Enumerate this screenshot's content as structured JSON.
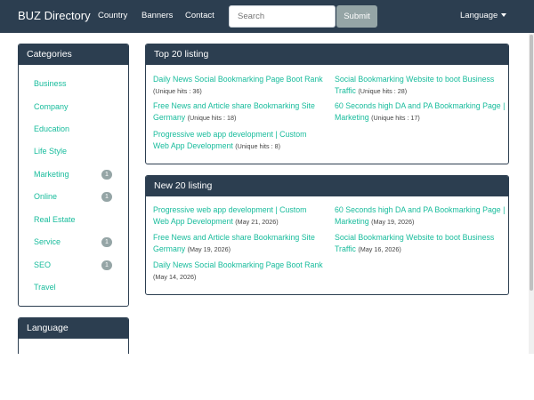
{
  "navbar": {
    "brand": "BUZ Directory",
    "links": [
      "Country",
      "Banners",
      "Contact"
    ],
    "search_placeholder": "Search",
    "submit_label": "Submit",
    "language_label": "Language"
  },
  "categories": {
    "title": "Categories",
    "items": [
      {
        "label": "Business",
        "badge": ""
      },
      {
        "label": "Company",
        "badge": ""
      },
      {
        "label": "Education",
        "badge": ""
      },
      {
        "label": "Life Style",
        "badge": ""
      },
      {
        "label": "Marketing",
        "badge": "1"
      },
      {
        "label": "Online",
        "badge": "1"
      },
      {
        "label": "Real Estate",
        "badge": ""
      },
      {
        "label": "Service",
        "badge": "1"
      },
      {
        "label": "SEO",
        "badge": "1"
      },
      {
        "label": "Travel",
        "badge": ""
      }
    ]
  },
  "language_panel": {
    "title": "Language"
  },
  "top_listing": {
    "title": "Top 20 listing",
    "items": [
      {
        "title": "Daily News Social Bookmarking Page Boot Rank",
        "meta": "(Unique hits : 36)"
      },
      {
        "title": "Social Bookmarking Website to boot Business Traffic",
        "meta": "(Unique hits : 28)"
      },
      {
        "title": "Free News and Article share Bookmarking Site Germany",
        "meta": "(Unique hits : 18)"
      },
      {
        "title": "60 Seconds high DA and PA Bookmarking Page | Marketing",
        "meta": "(Unique hits : 17)"
      },
      {
        "title": "Progressive web app development | Custom Web App Development",
        "meta": "(Unique hits : 8)"
      }
    ]
  },
  "new_listing": {
    "title": "New 20 listing",
    "items": [
      {
        "title": "Progressive web app development | Custom Web App Development",
        "meta": "(May 21, 2026)"
      },
      {
        "title": "60 Seconds high DA and PA Bookmarking Page | Marketing",
        "meta": "(May 19, 2026)"
      },
      {
        "title": "Free News and Article share Bookmarking Site Germany",
        "meta": "(May 19, 2026)"
      },
      {
        "title": "Social Bookmarking Website to boot Business Traffic",
        "meta": "(May 16, 2026)"
      },
      {
        "title": "Daily News Social Bookmarking Page Boot Rank",
        "meta": "(May 14, 2026)"
      }
    ]
  }
}
